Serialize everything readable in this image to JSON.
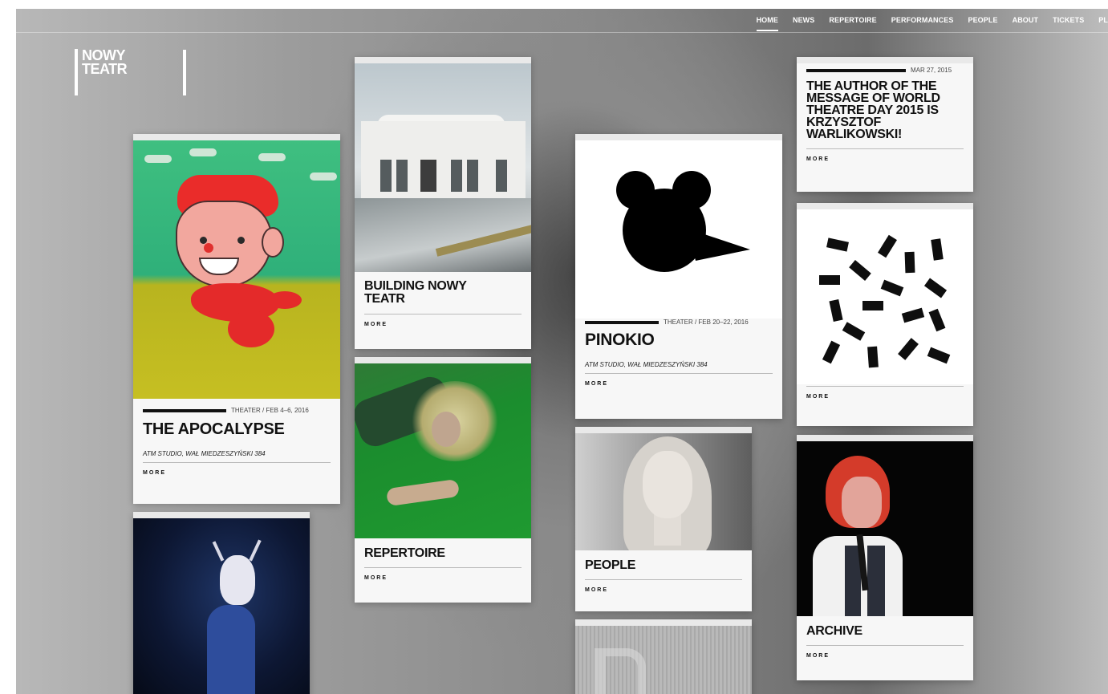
{
  "site": {
    "logo_line1": "NOWY",
    "logo_line2": "TEATR"
  },
  "nav": [
    "HOME",
    "NEWS",
    "REPERTOIRE",
    "PERFORMANCES",
    "PEOPLE",
    "ABOUT",
    "TICKETS",
    "PL"
  ],
  "nav_active": "HOME",
  "more_label": "MORE",
  "cards": {
    "apocalypse": {
      "meta": "THEATER / FEB 4–6, 2016",
      "title": "THE APOCALYPSE",
      "venue": "ATM STUDIO, WAŁ MIEDZESZYŃSKI 384"
    },
    "building": {
      "title": "BUILDING NOWY TEATR"
    },
    "repertoire": {
      "title": "REPERTOIRE"
    },
    "pinokio": {
      "meta": "THEATER / FEB 20–22, 2016",
      "title": "PINOKIO",
      "venue": "ATM STUDIO, WAŁ MIEDZESZYŃSKI 384"
    },
    "people": {
      "title": "PEOPLE"
    },
    "news": {
      "meta": "MAR 27, 2015",
      "title": "THE AUTHOR OF THE MESSAGE OF WORLD THEATRE DAY 2015 IS KRZYSZTOF WARLIKOWSKI!"
    },
    "confetti": {},
    "archive": {
      "title": "ARCHIVE"
    }
  },
  "colors": {
    "accent": "#111111",
    "card_bg": "#f7f7f7",
    "nav_text": "#ffffff"
  }
}
